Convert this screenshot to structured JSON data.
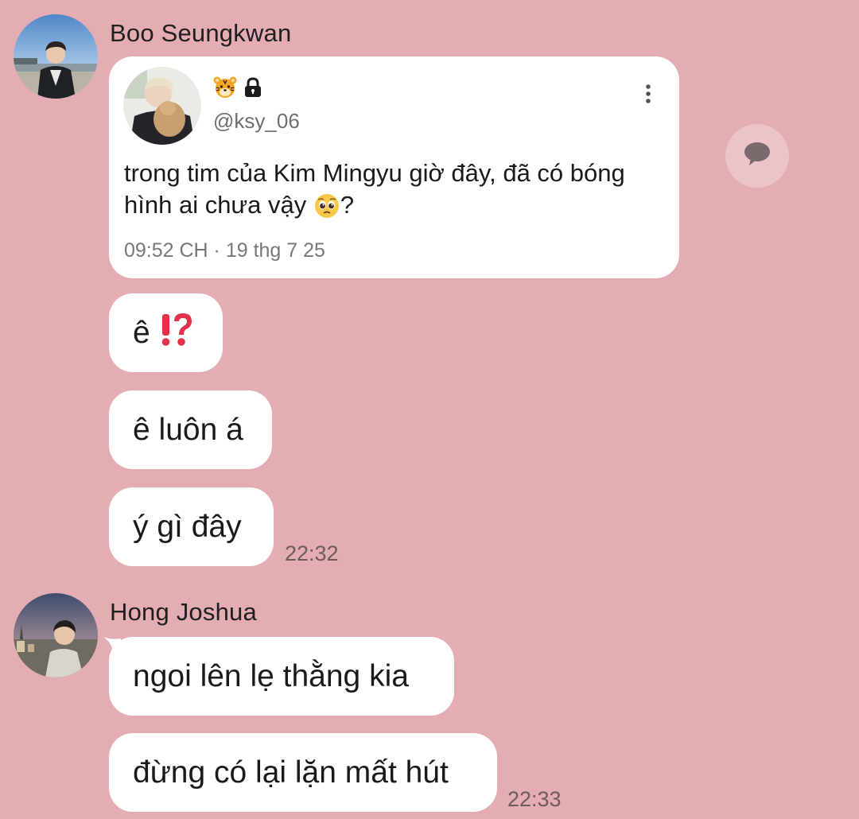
{
  "group1": {
    "sender": "Boo Seungkwan",
    "card": {
      "badge_emojis": [
        "tiger-face-icon",
        "lock-icon"
      ],
      "handle": "@ksy_06",
      "text_before_emoji": "trong tim của Kim Mingyu giờ đây, đã có bóng hình ai chưa vậy ",
      "text_emoji": "pleading-face-icon",
      "text_after_emoji": "?",
      "meta": "09:52 CH · 19 thg 7 25"
    },
    "messages": [
      {
        "text": "ê ",
        "emoji": "exclamation-question-icon"
      },
      {
        "text": "ê luôn á"
      },
      {
        "text": "ý gì đây"
      }
    ],
    "time": "22:32"
  },
  "group2": {
    "sender": "Hong Joshua",
    "messages": [
      {
        "text": "ngoi lên lẹ thằng kia"
      },
      {
        "text": "đừng có lại lặn mất hút"
      }
    ],
    "time": "22:33"
  },
  "colors": {
    "background": "#e4adb3",
    "bubble": "#ffffff",
    "comment_button": "#ebc3c8"
  }
}
